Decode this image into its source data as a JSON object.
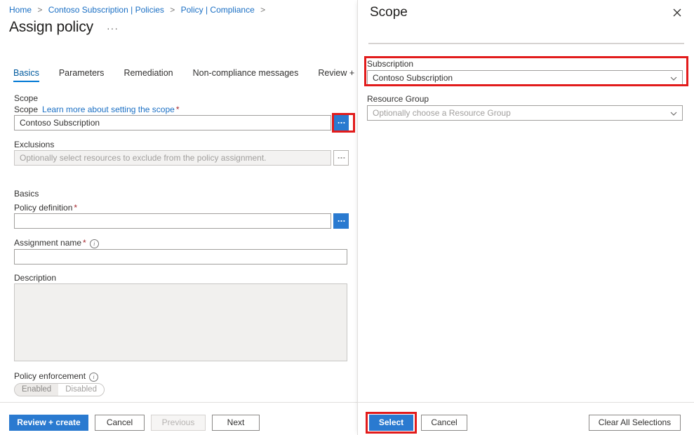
{
  "left_blade": {
    "breadcrumb": {
      "items": [
        "Home",
        "Contoso Subscription | Policies",
        "Policy | Compliance"
      ],
      "separator": ">"
    },
    "title": "Assign policy",
    "title_more_label": "···",
    "tabs": [
      {
        "label": "Basics",
        "active": true
      },
      {
        "label": "Parameters",
        "active": false
      },
      {
        "label": "Remediation",
        "active": false
      },
      {
        "label": "Non-compliance messages",
        "active": false
      },
      {
        "label": "Review + create",
        "active": false
      }
    ],
    "scope_section": {
      "heading": "Scope",
      "scope_label": "Scope",
      "scope_learn_more": "Learn more about setting the scope",
      "scope_required_mark": "*",
      "scope_value": "Contoso Subscription",
      "scope_browse_label": "···",
      "exclusions_label": "Exclusions",
      "exclusions_placeholder": "Optionally select resources to exclude from the policy assignment.",
      "exclusions_value": "",
      "exclusions_browse_label": "···"
    },
    "basics_section": {
      "heading": "Basics",
      "policy_definition_label": "Policy definition",
      "policy_definition_required_mark": "*",
      "policy_definition_value": "",
      "policy_definition_browse_label": "···",
      "assignment_name_label": "Assignment name",
      "assignment_name_required_mark": "*",
      "assignment_name_value": "",
      "description_label": "Description",
      "description_value": "",
      "policy_enforcement_label": "Policy enforcement",
      "policy_enforcement_options": [
        "Enabled",
        "Disabled"
      ],
      "policy_enforcement_selected": "Enabled"
    },
    "footer": {
      "review_create": "Review + create",
      "cancel": "Cancel",
      "previous": "Previous",
      "next": "Next"
    }
  },
  "right_panel": {
    "title": "Scope",
    "close_label": "✕",
    "subscription_label": "Subscription",
    "subscription_value": "Contoso Subscription",
    "resource_group_label": "Resource Group",
    "resource_group_placeholder": "Optionally choose a Resource Group",
    "resource_group_value": "",
    "footer": {
      "select": "Select",
      "cancel": "Cancel",
      "clear_all": "Clear All Selections"
    }
  },
  "colors": {
    "accent_blue": "#2a7ad0",
    "link_blue": "#1a6fc4",
    "annotation_red": "#e21b1b",
    "required_red": "#a4262c"
  }
}
